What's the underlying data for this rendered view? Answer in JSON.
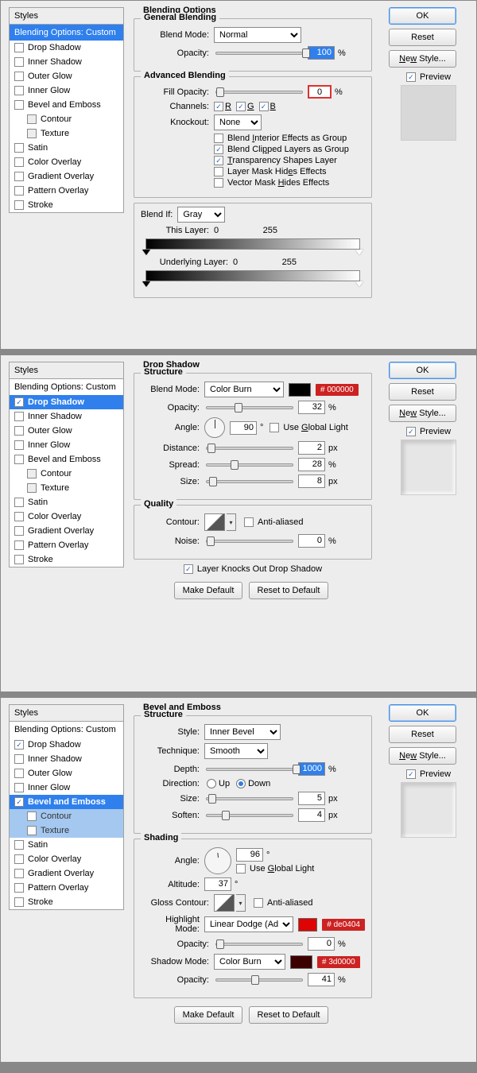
{
  "common": {
    "styles_hdr": "Styles",
    "buttons": {
      "ok": "OK",
      "reset": "Reset",
      "new_style": "New Style...",
      "make_default": "Make Default",
      "reset_default": "Reset to Default"
    },
    "preview_label": "Preview",
    "style_list": [
      {
        "label": "Drop Shadow"
      },
      {
        "label": "Inner Shadow"
      },
      {
        "label": "Outer Glow"
      },
      {
        "label": "Inner Glow"
      },
      {
        "label": "Bevel and Emboss"
      },
      {
        "label": "Contour",
        "indent": true
      },
      {
        "label": "Texture",
        "indent": true
      },
      {
        "label": "Satin"
      },
      {
        "label": "Color Overlay"
      },
      {
        "label": "Gradient Overlay"
      },
      {
        "label": "Pattern Overlay"
      },
      {
        "label": "Stroke"
      }
    ]
  },
  "panel1": {
    "blend_opts_row": "Blending Options: Custom",
    "pane_title": "Blending Options",
    "general": {
      "title": "General Blending",
      "blend_mode_lbl": "Blend Mode:",
      "blend_mode_val": "Normal",
      "opacity_lbl": "Opacity:",
      "opacity_val": "100",
      "opacity_unit": "%"
    },
    "advanced": {
      "title": "Advanced Blending",
      "fill_opacity_lbl": "Fill Opacity:",
      "fill_opacity_val": "0",
      "fill_opacity_unit": "%",
      "channels_lbl": "Channels:",
      "ch_r": "R",
      "ch_g": "G",
      "ch_b": "B",
      "knockout_lbl": "Knockout:",
      "knockout_val": "None",
      "opts": [
        {
          "chk": false,
          "txt_pre": "Blend ",
          "u": "I",
          "txt_post": "nterior Effects as Group"
        },
        {
          "chk": true,
          "txt_pre": "Blend Cli",
          "u": "p",
          "txt_post": "ped Layers as Group"
        },
        {
          "chk": true,
          "txt_pre": "",
          "u": "T",
          "txt_post": "ransparency Shapes Layer"
        },
        {
          "chk": false,
          "txt_pre": "Layer Mask Hid",
          "u": "e",
          "txt_post": "s Effects"
        },
        {
          "chk": false,
          "txt_pre": "Vector Mask ",
          "u": "H",
          "txt_post": "ides Effects"
        }
      ]
    },
    "blendif": {
      "title_lbl": "Blend If:",
      "val": "Gray",
      "this_layer_lbl": "This Layer:",
      "this_a": "0",
      "this_b": "255",
      "under_lbl": "Underlying Layer:",
      "under_a": "0",
      "under_b": "255"
    }
  },
  "panel2": {
    "blend_opts_row": "Blending Options: Custom",
    "pane_title": "Drop Shadow",
    "structure_title": "Structure",
    "blend_mode_lbl": "Blend Mode:",
    "blend_mode_val": "Color Burn",
    "color_hex": "#000000",
    "tag_color": "# 000000",
    "opacity_lbl": "Opacity:",
    "opacity_val": "32",
    "pct": "%",
    "angle_lbl": "Angle:",
    "angle_val": "90",
    "deg": "°",
    "use_global_lbl_pre": "Use ",
    "use_global_u": "G",
    "use_global_lbl_post": "lobal Light",
    "distance_lbl": "Distance:",
    "distance_val": "2",
    "px": "px",
    "spread_lbl": "Spread:",
    "spread_val": "28",
    "size_lbl": "Size:",
    "size_val": "8",
    "quality_title": "Quality",
    "contour_lbl": "Contour:",
    "antialias_lbl": "Anti-aliased",
    "noise_lbl": "Noise:",
    "noise_val": "0",
    "knocks_out_lbl": "Layer Knocks Out Drop Shadow"
  },
  "panel3": {
    "blend_opts_row": "Blending Options: Custom",
    "pane_title": "Bevel and Emboss",
    "structure_title": "Structure",
    "style_lbl": "Style:",
    "style_val": "Inner Bevel",
    "technique_lbl": "Technique:",
    "technique_val": "Smooth",
    "depth_lbl": "Depth:",
    "depth_val": "1000",
    "pct": "%",
    "direction_lbl": "Direction:",
    "up": "Up",
    "down": "Down",
    "size_lbl": "Size:",
    "size_val": "5",
    "px": "px",
    "soften_lbl": "Soften:",
    "soften_val": "4",
    "shading_title": "Shading",
    "angle_lbl": "Angle:",
    "angle_val": "96",
    "deg": "°",
    "use_global_lbl_pre": "Use ",
    "use_global_u": "G",
    "use_global_lbl_post": "lobal Light",
    "altitude_lbl": "Altitude:",
    "altitude_val": "37",
    "gloss_lbl": "Gloss Contour:",
    "antialias_lbl": "Anti-aliased",
    "hl_mode_lbl": "Highlight Mode:",
    "hl_mode_val": "Linear Dodge (Add)",
    "hl_color": "#de0404",
    "hl_tag": "# de0404",
    "hl_opacity_lbl": "Opacity:",
    "hl_opacity_val": "0",
    "sh_mode_lbl": "Shadow Mode:",
    "sh_mode_val": "Color Burn",
    "sh_color": "#3d0000",
    "sh_tag": "# 3d0000",
    "sh_opacity_lbl": "Opacity:",
    "sh_opacity_val": "41"
  }
}
